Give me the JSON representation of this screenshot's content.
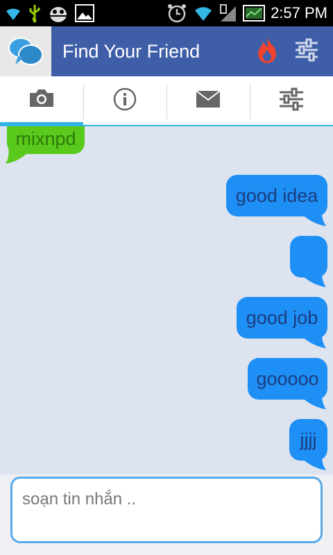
{
  "status_bar": {
    "time": "2:57 PM",
    "icons": [
      "wifi-icon",
      "usb-icon",
      "android-debug-icon",
      "image-icon",
      "alarm-clock-icon",
      "wifi-icon",
      "signal-icon",
      "battery-icon"
    ]
  },
  "app_bar": {
    "logo_icon": "rate-a-friend-logo",
    "title": "Find Your Friend",
    "actions": [
      "flame-icon",
      "sliders-icon"
    ]
  },
  "tabs": [
    {
      "icon": "camera-icon",
      "active": true
    },
    {
      "icon": "info-icon",
      "active": false
    },
    {
      "icon": "mail-icon",
      "active": false
    },
    {
      "icon": "sliders-icon",
      "active": false
    }
  ],
  "messages": [
    {
      "side": "in",
      "text": "mixnpd"
    },
    {
      "side": "out",
      "text": "good idea"
    },
    {
      "side": "out",
      "text": ""
    },
    {
      "side": "out",
      "text": "good job"
    },
    {
      "side": "out",
      "text": "gooooo"
    },
    {
      "side": "out",
      "text": "jjjj"
    }
  ],
  "composer": {
    "placeholder": "soạn tin nhắn .."
  },
  "colors": {
    "app_bar": "#3f5ea8",
    "tab_accent": "#33b5e5",
    "outgoing_bubble": "#1e8ff5",
    "incoming_bubble": "#59c91b",
    "chat_background": "#dde3ef"
  }
}
